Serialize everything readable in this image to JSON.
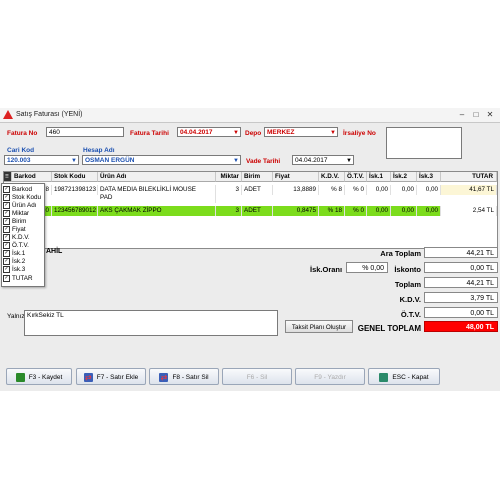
{
  "window": {
    "title": "Satış Faturası (YENİ)",
    "minimize": "–",
    "maximize": "□",
    "close": "✕"
  },
  "header": {
    "fatura_no_label": "Fatura No",
    "fatura_no_value": "460",
    "fatura_tarihi_label": "Fatura Tarihi",
    "fatura_tarihi_value": "04.04.2017",
    "depo_label": "Depo",
    "depo_value": "MERKEZ",
    "irsaliye_no_label": "İrsaliye No",
    "cari_kod_label": "Cari Kod",
    "cari_kod_value": "120.003",
    "hesap_adi_label": "Hesap Adı",
    "hesap_adi_value": "OSMAN ERGÜN",
    "vade_tarihi_label": "Vade Tarihi",
    "vade_tarihi_value": "04.04.2017"
  },
  "grid": {
    "columns": [
      "Barkod",
      "Stok Kodu",
      "Ürün Adı",
      "Miktar",
      "Birim",
      "Fiyat",
      "K.D.V.",
      "Ö.T.V.",
      "İsk.1",
      "İsk.2",
      "İsk.3",
      "TUTAR"
    ],
    "rows": [
      {
        "barkod": "8",
        "stok_kodu": "198721398123",
        "urun_adi_1": "DATA MEDIA BILEKLİKLİ  MOUSE",
        "urun_adi_2": "PAD",
        "miktar": "3",
        "birim": "ADET",
        "fiyat": "13,8889",
        "kdv": "% 8",
        "otv": "% 0",
        "isk1": "0,00",
        "isk2": "0,00",
        "isk3": "0,00",
        "tutar": "41,67 TL"
      },
      {
        "barkod": "0",
        "stok_kodu": "123456789012",
        "urun_adi_1": "AKS ÇAKMAK ZİPPO",
        "urun_adi_2": "",
        "miktar": "3",
        "birim": "ADET",
        "fiyat": "0,8475",
        "kdv": "% 18",
        "otv": "% 0",
        "isk1": "0,00",
        "isk2": "0,00",
        "isk3": "0,00",
        "tutar": "2,54 TL"
      }
    ]
  },
  "column_menu": {
    "items": [
      "Barkod",
      "Stok Kodu",
      "Ürün Adı",
      "Miktar",
      "Birim",
      "Fiyat",
      "K.D.V.",
      "Ö.T.V.",
      "İsk.1",
      "İsk.2",
      "İsk.3",
      "TUTAR"
    ]
  },
  "partial_label": "AHİL",
  "totals": {
    "ara_toplam_label": "Ara Toplam",
    "ara_toplam_value": "44,21 TL",
    "isk_orani_label": "İsk.Oranı",
    "isk_orani_value": "% 0,00",
    "iskonto_label": "İskonto",
    "iskonto_value": "0,00 TL",
    "toplam_label": "Toplam",
    "toplam_value": "44,21 TL",
    "kdv_label": "K.D.V.",
    "kdv_value": "3,79 TL",
    "otv_label": "Ö.T.V.",
    "otv_value": "0,00 TL",
    "genel_toplam_label": "GENEL TOPLAM",
    "genel_toplam_value": "48,00 TL"
  },
  "yalniz": {
    "label": "Yalnız",
    "value": "KırkSekiz TL"
  },
  "taksit_button": "Taksit Planı Oluştur",
  "footer": {
    "kaydet": "F3 - Kaydet",
    "satir_ekle": "F7 - Satır Ekle",
    "satir_sil": "F8 - Satır Sil",
    "sil": "F6 - Sil",
    "yazdir": "F9 - Yazdır",
    "kapat": "ESC - Kapat"
  },
  "colors": {
    "accent_red": "#cc0000",
    "accent_blue": "#1a4fb0",
    "selected_row": "#7cdc1c",
    "genel_toplam_bg": "#ff0000"
  }
}
